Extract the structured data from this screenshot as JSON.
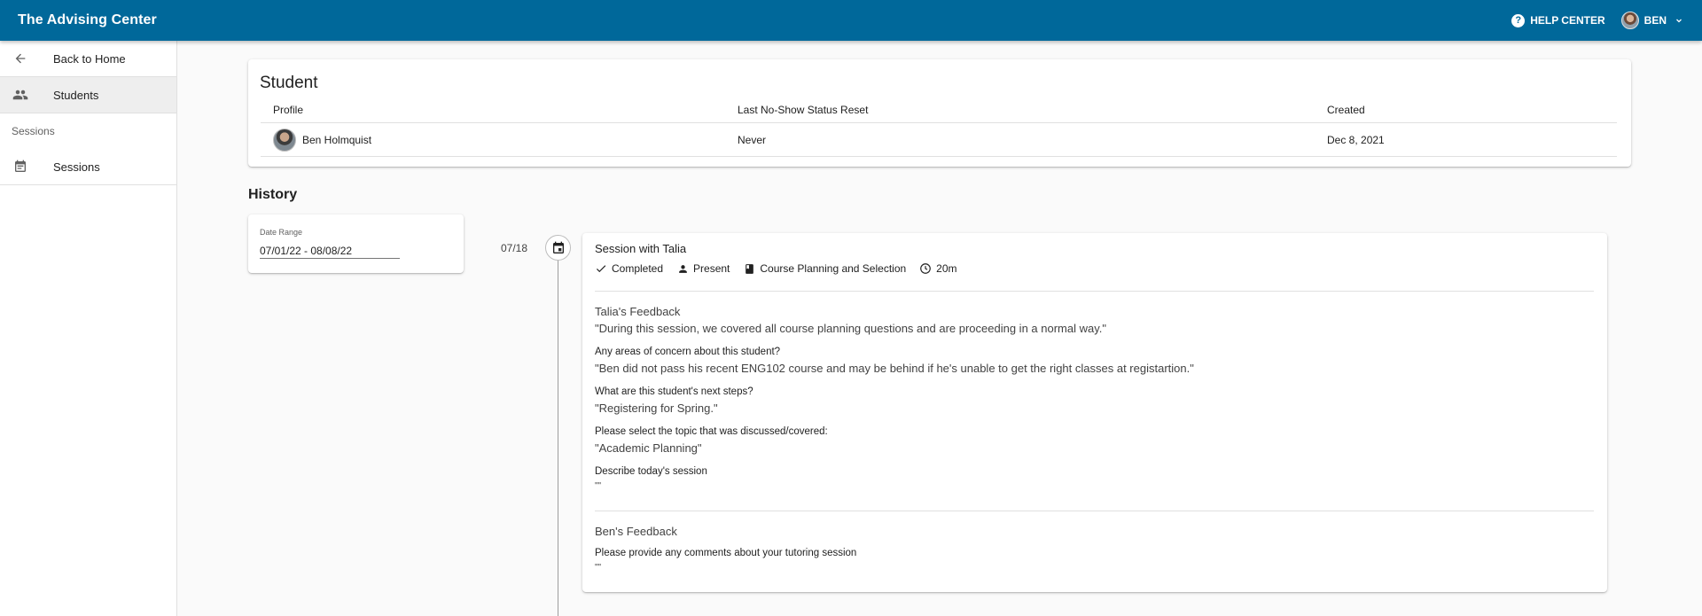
{
  "header": {
    "title": "The Advising Center",
    "help_label": "HELP CENTER",
    "user_label": "BEN"
  },
  "sidebar": {
    "back_label": "Back to Home",
    "students_label": "Students",
    "sessions_subheader": "Sessions",
    "sessions_label": "Sessions"
  },
  "student": {
    "title": "Student",
    "columns": [
      "Profile",
      "Last No-Show Status Reset",
      "Created"
    ],
    "row": {
      "name": "Ben Holmquist",
      "last_reset": "Never",
      "created": "Dec 8, 2021"
    }
  },
  "history": {
    "title": "History",
    "date_range_label": "Date Range",
    "date_range_value": "07/01/22 - 08/08/22"
  },
  "session": {
    "date": "07/18",
    "title": "Session with Talia",
    "chips": {
      "status": "Completed",
      "attendance": "Present",
      "topic": "Course Planning and Selection",
      "duration": "20m"
    },
    "tutor_feedback": {
      "heading": "Talia's Feedback",
      "summary": "\"During this session, we covered all course planning questions and are proceeding in a normal way.\"",
      "q1": "Any areas of concern about this student?",
      "a1": "\"Ben did not pass his recent ENG102 course and may be behind if he's unable to get the right classes at registartion.\"",
      "q2": "What are this student's next steps?",
      "a2": "\"Registering for Spring.\"",
      "q3": "Please select the topic that was discussed/covered:",
      "a3": "\"Academic Planning\"",
      "q4": "Describe today's session",
      "a4": "\"\""
    },
    "student_feedback": {
      "heading": "Ben's Feedback",
      "q1": "Please provide any comments about your tutoring session",
      "a1": "\"\""
    }
  }
}
